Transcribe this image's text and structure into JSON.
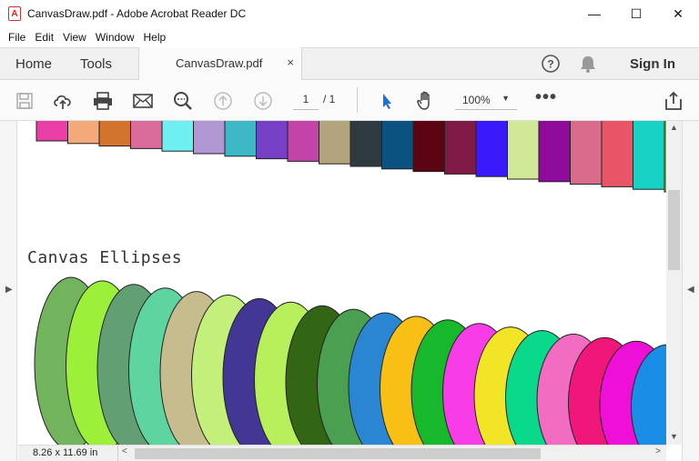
{
  "window": {
    "title": "CanvasDraw.pdf - Adobe Acrobat Reader DC",
    "app_icon": "pdf-icon",
    "minimize": "—",
    "maximize": "☐",
    "close": "✕"
  },
  "menu": [
    "File",
    "Edit",
    "View",
    "Window",
    "Help"
  ],
  "tabs": {
    "home": "Home",
    "tools": "Tools",
    "document": "CanvasDraw.pdf",
    "close_glyph": "×",
    "sign_in": "Sign In"
  },
  "toolbar": {
    "icons": [
      "save-icon",
      "upload-icon",
      "print-icon",
      "email-icon",
      "zoom-search-icon",
      "page-up-icon",
      "page-down-icon",
      "select-cursor-icon",
      "hand-icon",
      "more-icon",
      "share-icon"
    ],
    "page_current": "1",
    "page_total": "/ 1",
    "zoom": "100%",
    "zoom_caret": "▼",
    "more": "•••"
  },
  "document": {
    "heading": "Canvas Ellipses",
    "top_bar_colors": [
      "#e83ea5",
      "#f4a97a",
      "#d2732e",
      "#d96b9b",
      "#6eeff0",
      "#b096d3",
      "#3cb8c6",
      "#7640c6",
      "#c443a8",
      "#b3a47c",
      "#2e3a40",
      "#0b5280",
      "#5b0512",
      "#801a46",
      "#3a19fa",
      "#d1e898",
      "#8e0b9b",
      "#d96c8b",
      "#e85566",
      "#19d2c6",
      "#62c12a"
    ],
    "ellipse_colors": [
      "#72b35e",
      "#9cf03a",
      "#62a074",
      "#5ed5a1",
      "#c6bc8e",
      "#c2f07a",
      "#423795",
      "#b8f05c",
      "#326514",
      "#4aa050",
      "#2a86d2",
      "#f8c014",
      "#18b82c",
      "#f83de8",
      "#f2e426",
      "#08d98a",
      "#f26cc2",
      "#f0167a",
      "#ee10d6",
      "#1a8de6"
    ]
  },
  "status": {
    "page_size": "8.26 x 11.69 in",
    "left_arrow": "<",
    "right_arrow": ">",
    "up_arrow": "▲",
    "down_arrow": "▼"
  }
}
